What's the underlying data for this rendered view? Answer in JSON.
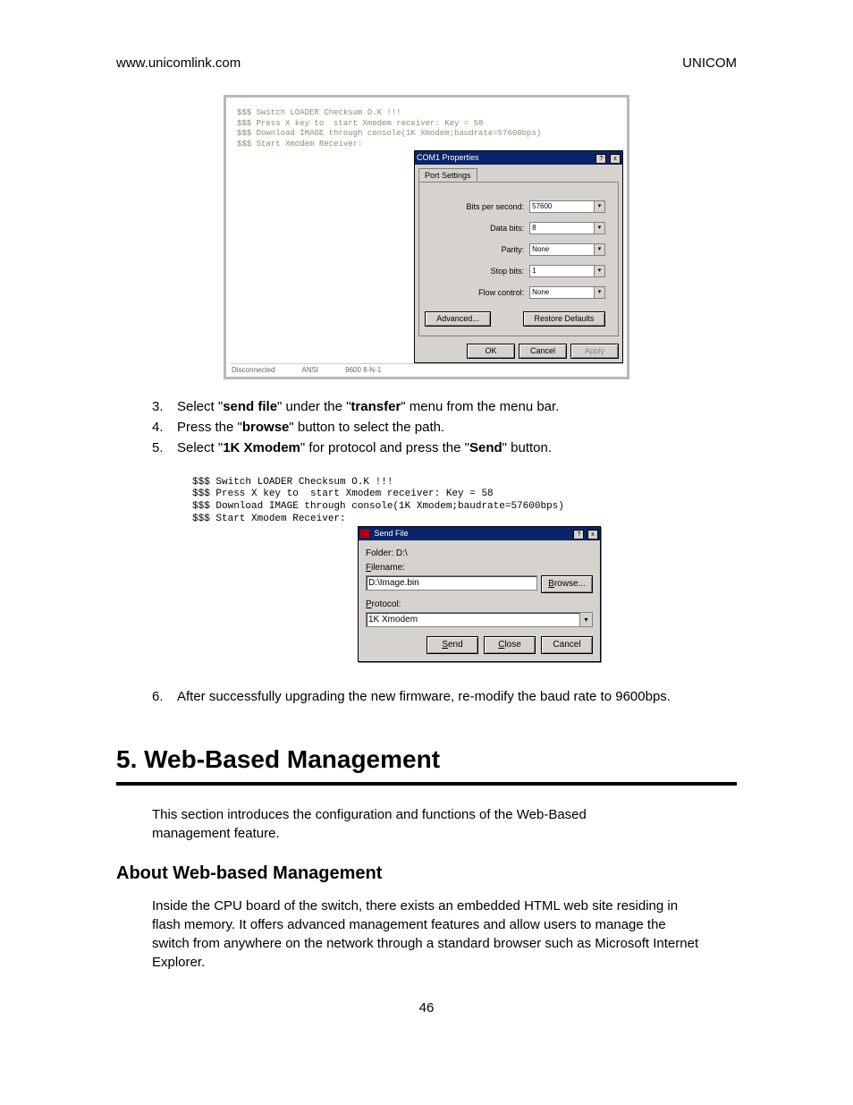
{
  "header": {
    "left": "www.unicomlink.com",
    "right": "UNICOM"
  },
  "shot1": {
    "terminal": "$$$ Switch LOADER Checksum O.K !!!\n$$$ Press X key to  start Xmodem receiver: Key = 58\n$$$ Download IMAGE through console(1K Xmodem;baudrate=57600bps)\n$$$ Start Xmodem Receiver:",
    "dialog_title": "COM1 Properties",
    "tab": "Port Settings",
    "bps": {
      "label": "Bits per second:",
      "value": "57600"
    },
    "data": {
      "label": "Data bits:",
      "value": "8"
    },
    "parity": {
      "label": "Parity:",
      "value": "None"
    },
    "stop": {
      "label": "Stop bits:",
      "value": "1"
    },
    "flow": {
      "label": "Flow control:",
      "value": "None"
    },
    "advanced": "Advanced...",
    "restore": "Restore Defaults",
    "ok": "OK",
    "cancel": "Cancel",
    "apply": "Apply",
    "status": {
      "s1": "Disconnected",
      "s2": "ANSI",
      "s3": "9600 8-N-1"
    }
  },
  "inst1": [
    {
      "n": "3.",
      "pre": "Select \"",
      "b1": "send file",
      "mid1": "\" under the \"",
      "b2": "transfer",
      "post": "\" menu from the menu bar."
    },
    {
      "n": "4.",
      "pre": "Press the \"",
      "b1": "browse",
      "mid1": "\" button to select the path.",
      "b2": "",
      "post": ""
    },
    {
      "n": "5.",
      "pre": "Select \"",
      "b1": "1K Xmodem",
      "mid1": "\" for protocol and press the \"",
      "b2": "Send",
      "post": "\" button."
    }
  ],
  "shot2": {
    "terminal": "$$$ Switch LOADER Checksum O.K !!!\n$$$ Press X key to  start Xmodem receiver: Key = 58\n$$$ Download IMAGE through console(1K Xmodem;baudrate=57600bps)\n$$$ Start Xmodem Receiver:",
    "dialog_title": "Send File",
    "folder_label": "Folder: D:\\",
    "filename_label": "Filename:",
    "filename_value": "D:\\Image.bin",
    "browse": "Browse...",
    "protocol_label": "Protocol:",
    "protocol_value": "1K Xmodem",
    "send": "Send",
    "close": "Close",
    "cancel": "Cancel"
  },
  "inst2": {
    "n": "6.",
    "text": "After successfully upgrading the new firmware, re-modify the baud rate to 9600bps."
  },
  "chapter": "5.  Web-Based Management",
  "intro": "This section introduces the configuration and functions of the Web-Based management feature.",
  "subhead": "About Web-based Management",
  "para2": "Inside the CPU board of the switch, there exists an embedded HTML web site residing in flash memory. It offers advanced management features and allow users to manage the switch from anywhere on the network through a standard browser such as Microsoft Internet Explorer.",
  "page": "46"
}
